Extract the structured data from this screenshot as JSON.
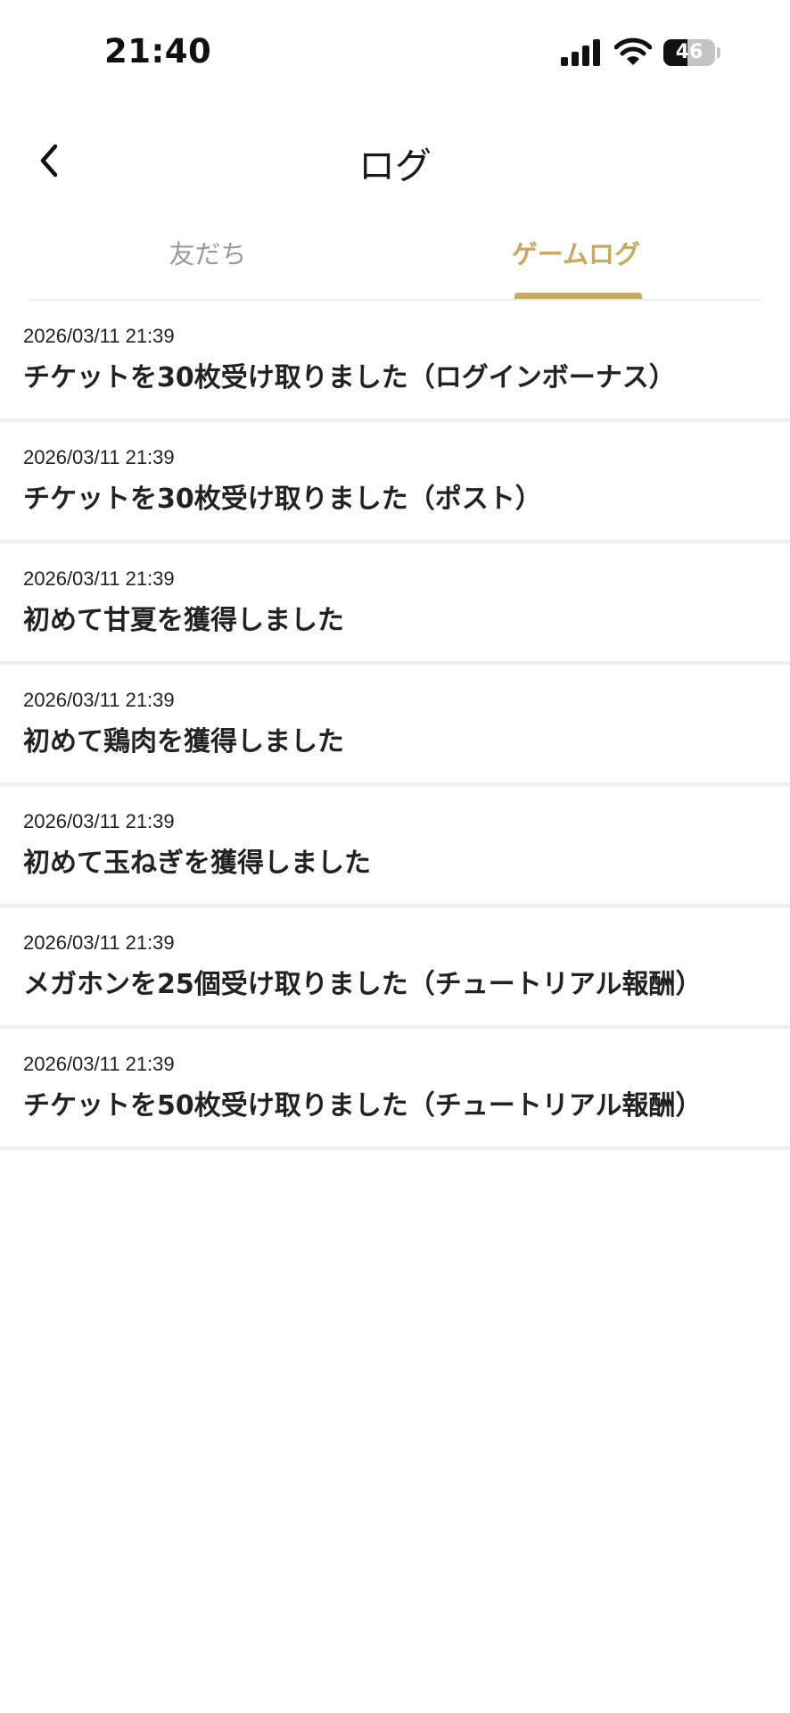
{
  "status_bar": {
    "time": "21:40",
    "battery_text": "46",
    "battery_level": 0.46,
    "icons": [
      "cellular-signal-icon",
      "wifi-icon",
      "battery-icon"
    ]
  },
  "nav": {
    "title": "ログ",
    "back_icon": "chevron-left-icon"
  },
  "tabs": [
    {
      "label": "友だち",
      "active": false
    },
    {
      "label": "ゲームログ",
      "active": true
    }
  ],
  "colors": {
    "accent": "#c9a95f",
    "inactive_tab": "#9a9a9a",
    "divider": "#eeeeee"
  },
  "logs": [
    {
      "date": "2026/03/11 21:39",
      "text": "チケットを30枚受け取りました（ログインボーナス）"
    },
    {
      "date": "2026/03/11 21:39",
      "text": "チケットを30枚受け取りました（ポスト）"
    },
    {
      "date": "2026/03/11 21:39",
      "text": "初めて甘夏を獲得しました"
    },
    {
      "date": "2026/03/11 21:39",
      "text": "初めて鶏肉を獲得しました"
    },
    {
      "date": "2026/03/11 21:39",
      "text": "初めて玉ねぎを獲得しました"
    },
    {
      "date": "2026/03/11 21:39",
      "text": "メガホンを25個受け取りました（チュートリアル報酬）"
    },
    {
      "date": "2026/03/11 21:39",
      "text": "チケットを50枚受け取りました（チュートリアル報酬）"
    }
  ]
}
